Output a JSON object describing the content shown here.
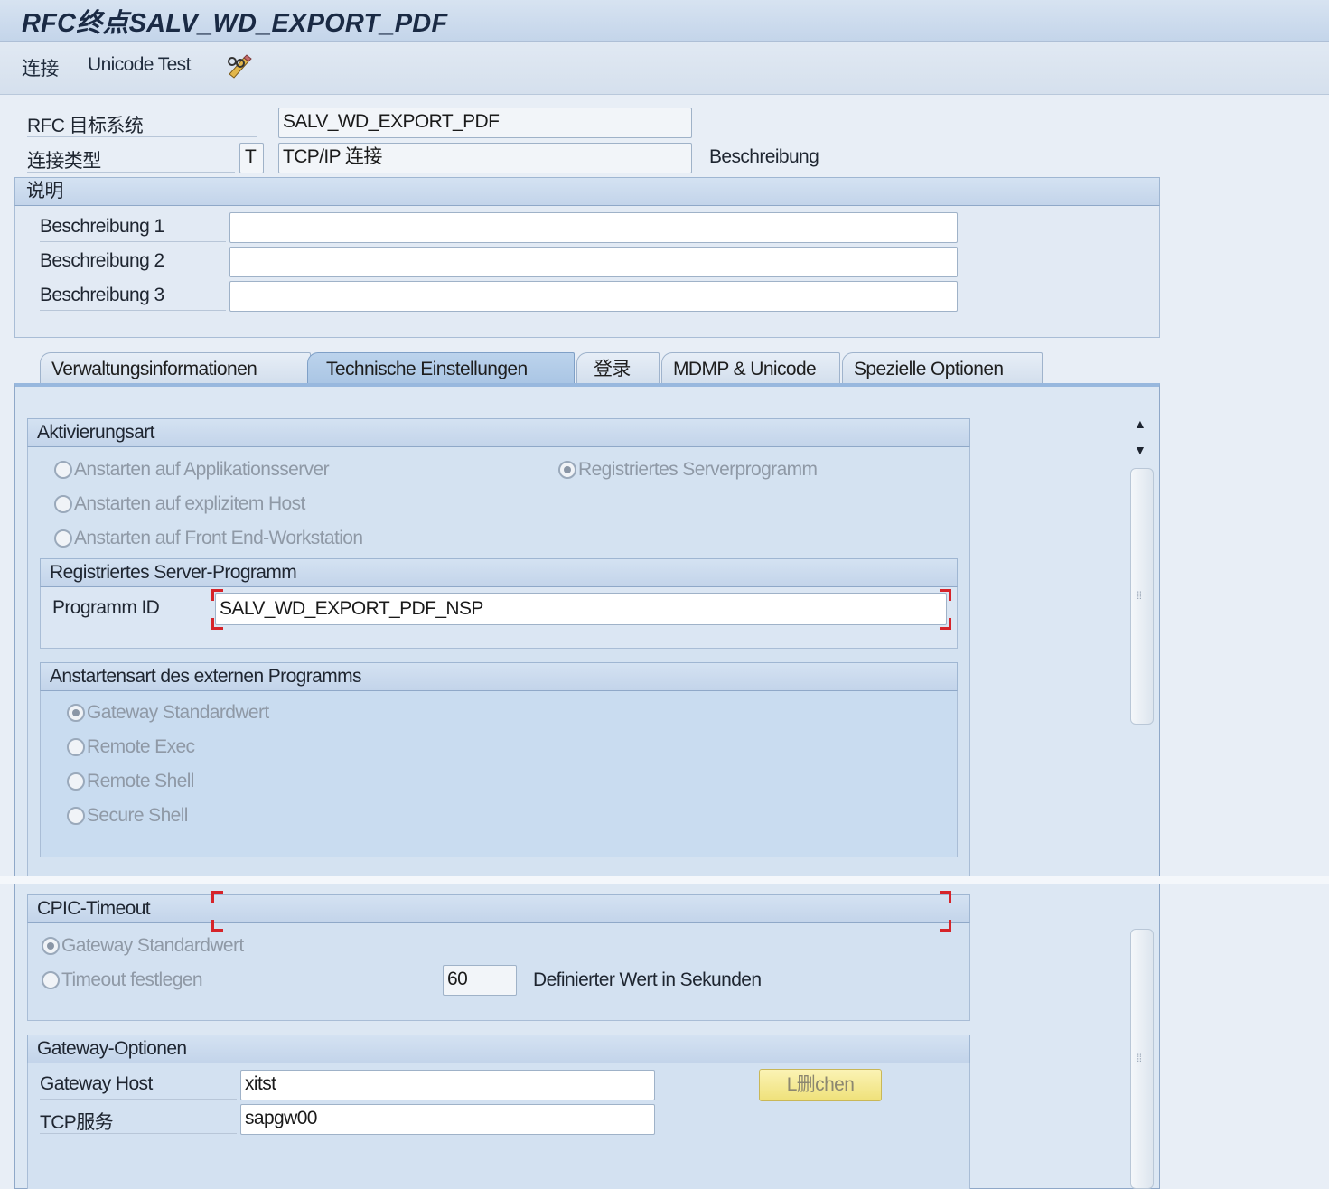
{
  "window": {
    "title": "RFC终点SALV_WD_EXPORT_PDF"
  },
  "toolbar": {
    "connection_label": "连接",
    "unicode_test_label": "Unicode Test",
    "edit_icon": "pencil-glasses-icon"
  },
  "header": {
    "rfc_target_label": "RFC 目标系统",
    "rfc_target_value": "SALV_WD_EXPORT_PDF",
    "conn_type_label": "连接类型",
    "conn_type_code": "T",
    "conn_type_value": "TCP/IP 连接",
    "description_caption": "Beschreibung"
  },
  "description_group": {
    "title": "说明",
    "fields": [
      {
        "label": "Beschreibung 1",
        "value": ""
      },
      {
        "label": "Beschreibung 2",
        "value": ""
      },
      {
        "label": "Beschreibung 3",
        "value": ""
      }
    ]
  },
  "tabs": [
    {
      "label": "Verwaltungsinformationen",
      "active": false
    },
    {
      "label": "Technische Einstellungen",
      "active": true
    },
    {
      "label": "登录",
      "active": false
    },
    {
      "label": "MDMP & Unicode",
      "active": false
    },
    {
      "label": "Spezielle Optionen",
      "active": false
    }
  ],
  "activation": {
    "title": "Aktivierungsart",
    "options": [
      "Anstarten auf Applikationsserver",
      "Anstarten auf explizitem Host",
      "Anstarten auf Front End-Workstation"
    ],
    "selected_option": "Registriertes Serverprogramm"
  },
  "registered_server": {
    "title": "Registriertes Server-Programm",
    "program_id_label": "Programm ID",
    "program_id_value": "SALV_WD_EXPORT_PDF_NSP"
  },
  "start_type": {
    "title": "Anstartensart des externen Programms",
    "options": [
      "Gateway Standardwert",
      "Remote Exec",
      "Remote Shell",
      "Secure Shell"
    ],
    "selected": "Gateway Standardwert"
  },
  "cpic_timeout": {
    "title": "CPIC-Timeout",
    "option_default": "Gateway Standardwert",
    "option_set": "Timeout festlegen",
    "timeout_value": "60",
    "timeout_caption": "Definierter Wert in Sekunden"
  },
  "gateway": {
    "title": "Gateway-Optionen",
    "host_label": "Gateway Host",
    "host_value": "xitst",
    "service_label": "TCP服务",
    "service_value": "sapgw00",
    "delete_button": "L删chen"
  },
  "colors": {
    "title_bar": "#c4d5ea",
    "active_tab": "#a9c5e4",
    "focus_marker": "#d6242a",
    "delete_button": "#efe17a"
  }
}
